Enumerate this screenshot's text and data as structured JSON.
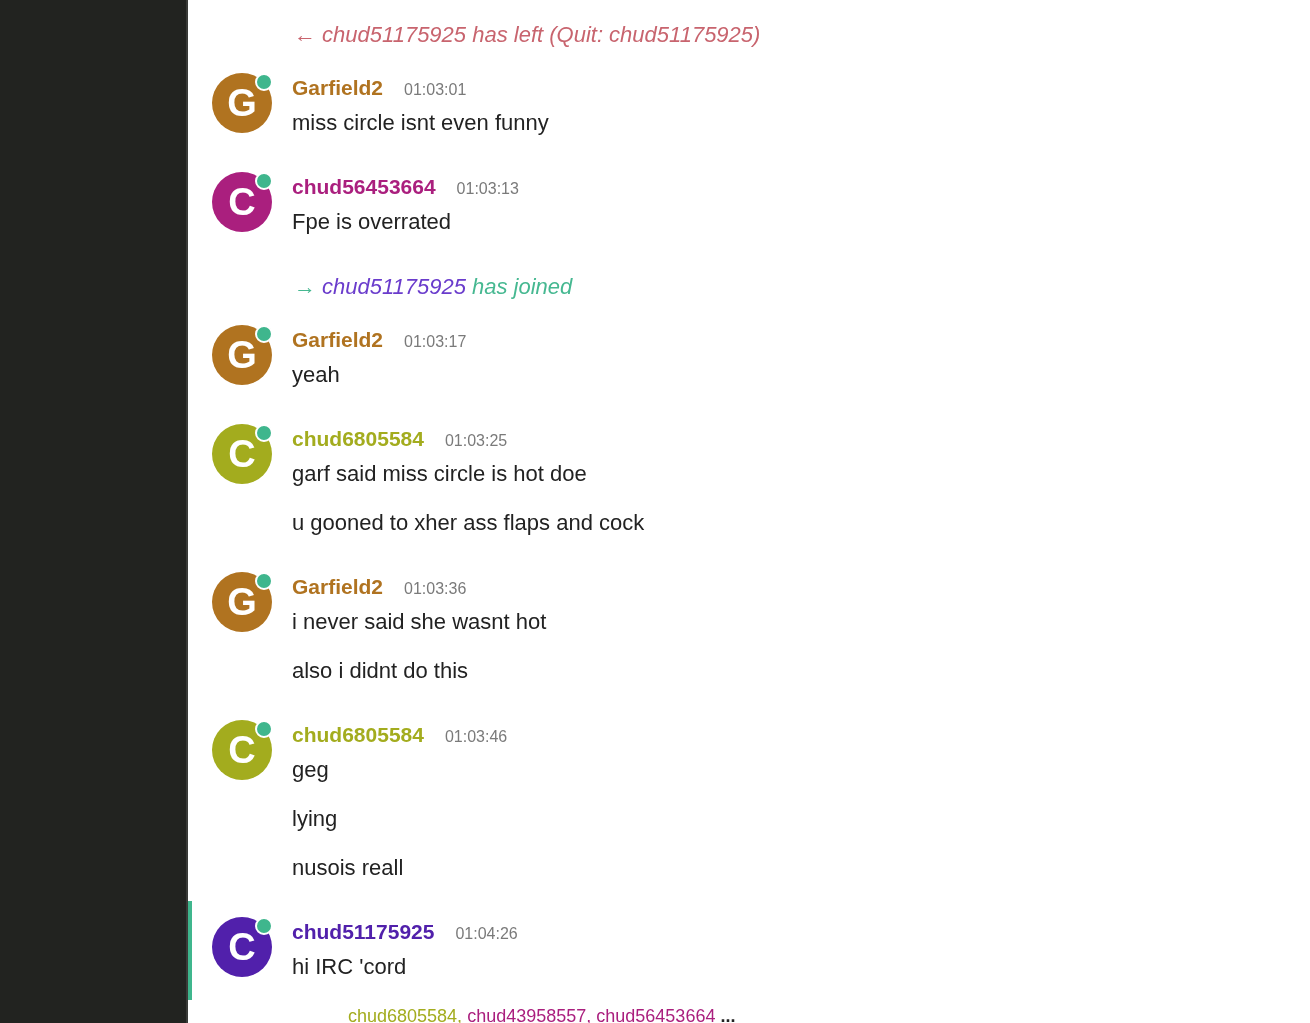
{
  "messages": [
    {
      "kind": "event",
      "parts": [
        {
          "text": "← chud51175925 has left (Quit: chud51175925)",
          "color": "#c8646e"
        }
      ]
    },
    {
      "kind": "message",
      "author": "Garfield2",
      "initial": "G",
      "color": "#b07320",
      "online": true,
      "highlighted": false,
      "time": "01:03:01",
      "lines": [
        "miss circle isnt even funny"
      ]
    },
    {
      "kind": "message",
      "author": "chud56453664",
      "initial": "C",
      "color": "#aa1f7e",
      "online": true,
      "highlighted": false,
      "time": "01:03:13",
      "lines": [
        "Fpe is overrated"
      ]
    },
    {
      "kind": "event",
      "parts": [
        {
          "text": "→",
          "color": "#46b891"
        },
        {
          "text": "chud51175925",
          "color": "#6a3ccc"
        },
        {
          "text": "has joined",
          "color": "#46b891"
        }
      ]
    },
    {
      "kind": "message",
      "author": "Garfield2",
      "initial": "G",
      "color": "#b07320",
      "online": true,
      "highlighted": false,
      "time": "01:03:17",
      "lines": [
        "yeah"
      ]
    },
    {
      "kind": "message",
      "author": "chud6805584",
      "initial": "C",
      "color": "#a3ac1e",
      "online": true,
      "highlighted": false,
      "time": "01:03:25",
      "lines": [
        "garf said miss circle is hot doe",
        "u gooned to xher ass flaps and cock"
      ]
    },
    {
      "kind": "message",
      "author": "Garfield2",
      "initial": "G",
      "color": "#b07320",
      "online": true,
      "highlighted": false,
      "time": "01:03:36",
      "lines": [
        "i never said she wasnt hot",
        "also i didnt do this"
      ]
    },
    {
      "kind": "message",
      "author": "chud6805584",
      "initial": "C",
      "color": "#a3ac1e",
      "online": true,
      "highlighted": false,
      "time": "01:03:46",
      "lines": [
        "geg",
        "lying",
        "nusois reall"
      ]
    },
    {
      "kind": "message",
      "author": "chud51175925",
      "initial": "C",
      "color": "#5120ab",
      "online": true,
      "highlighted": true,
      "time": "01:04:26",
      "lines": [
        "hi IRC 'cord"
      ]
    }
  ],
  "typing": {
    "users": [
      {
        "name": "chud6805584",
        "color": "#a3ac1e",
        "suffix": ","
      },
      {
        "name": "chud43958557",
        "color": "#aa1f7e",
        "suffix": ","
      },
      {
        "name": "chud56453664",
        "color": "#aa1f7e"
      }
    ],
    "ellipsis": "..."
  }
}
